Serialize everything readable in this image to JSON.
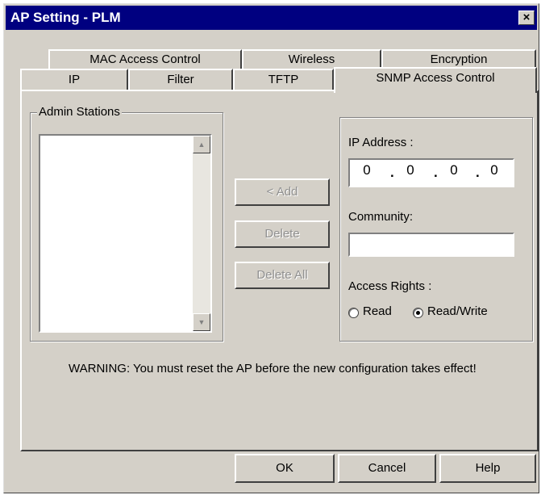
{
  "window": {
    "title": "AP Setting - PLM",
    "close_glyph": "×"
  },
  "tabs": {
    "row1": [
      "MAC Access Control",
      "Wireless",
      "Encryption"
    ],
    "row2": [
      "IP",
      "Filter",
      "TFTP",
      "SNMP Access Control"
    ],
    "active": "SNMP Access Control"
  },
  "admin_stations": {
    "group_label": "Admin Stations",
    "items": []
  },
  "buttons": {
    "add": "<   Add",
    "delete": "Delete",
    "delete_all": "Delete All"
  },
  "ip_address": {
    "label": "IP Address :",
    "octets": [
      "0",
      "0",
      "0",
      "0"
    ]
  },
  "community": {
    "label": "Community:",
    "value": ""
  },
  "access_rights": {
    "label": "Access Rights :",
    "options": [
      "Read",
      "Read/Write"
    ],
    "selected": "Read/Write"
  },
  "warning": "WARNING: You must reset the AP before the new configuration takes effect!",
  "footer": {
    "ok": "OK",
    "cancel": "Cancel",
    "help": "Help"
  }
}
